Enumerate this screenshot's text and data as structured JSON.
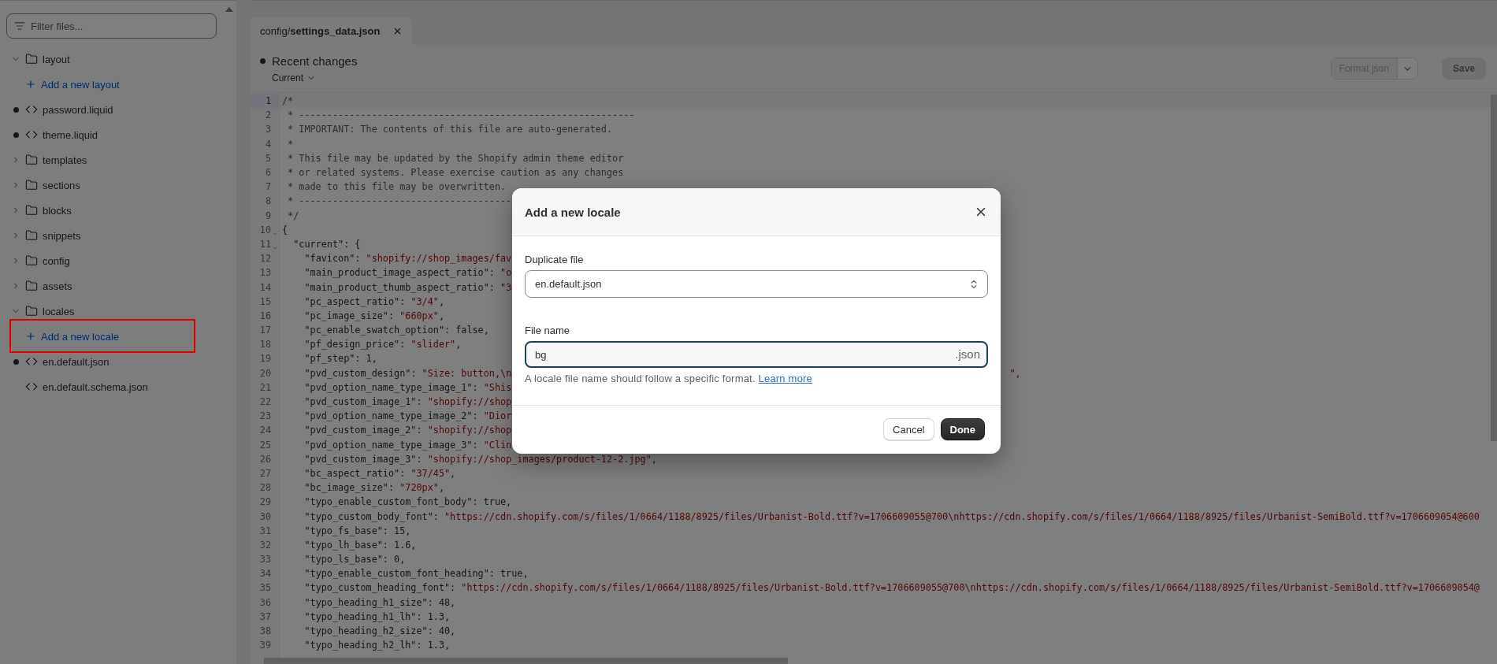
{
  "sidebar": {
    "filter": {
      "placeholder": "Filter files..."
    },
    "items": [
      {
        "kind": "folder",
        "label": "layout",
        "expanded": true,
        "children": [
          {
            "kind": "add",
            "label": "Add a new layout",
            "highlighted": false
          },
          {
            "kind": "file",
            "label": "password.liquid",
            "modified": true
          },
          {
            "kind": "file",
            "label": "theme.liquid",
            "modified": true
          }
        ]
      },
      {
        "kind": "folder",
        "label": "templates",
        "expanded": false
      },
      {
        "kind": "folder",
        "label": "sections",
        "expanded": false
      },
      {
        "kind": "folder",
        "label": "blocks",
        "expanded": false
      },
      {
        "kind": "folder",
        "label": "snippets",
        "expanded": false
      },
      {
        "kind": "folder",
        "label": "config",
        "expanded": false
      },
      {
        "kind": "folder",
        "label": "assets",
        "expanded": false
      },
      {
        "kind": "folder",
        "label": "locales",
        "expanded": true,
        "children": [
          {
            "kind": "add",
            "label": "Add a new locale",
            "highlighted": true
          },
          {
            "kind": "file",
            "label": "en.default.json",
            "modified": true
          },
          {
            "kind": "file",
            "label": "en.default.schema.json",
            "modified": false
          }
        ]
      }
    ]
  },
  "editor": {
    "tab": {
      "label": "config/**settings_data.json**"
    },
    "changes": {
      "title": "Recent changes",
      "version": "Current"
    },
    "format_button": {
      "label": "Format json",
      "disabled": true
    },
    "save_button": {
      "label": "Save",
      "disabled": true
    },
    "code_lines": [
      {
        "n": "1",
        "kind": "comment",
        "text": "/*",
        "active": true,
        "fold": false
      },
      {
        "n": "2",
        "kind": "comment",
        "text": " * ------------------------------------------------------------",
        "active": false,
        "fold": false
      },
      {
        "n": "3",
        "kind": "comment",
        "text": " * IMPORTANT: The contents of this file are auto-generated.",
        "active": false,
        "fold": false
      },
      {
        "n": "4",
        "kind": "comment",
        "text": " *",
        "active": false,
        "fold": false
      },
      {
        "n": "5",
        "kind": "comment",
        "text": " * This file may be updated by the Shopify admin theme editor",
        "active": false,
        "fold": false
      },
      {
        "n": "6",
        "kind": "comment",
        "text": " * or related systems. Please exercise caution as any changes",
        "active": false,
        "fold": false
      },
      {
        "n": "7",
        "kind": "comment",
        "text": " * made to this file may be overwritten.",
        "active": false,
        "fold": false
      },
      {
        "n": "8",
        "kind": "comment",
        "text": " * --------------------------------------",
        "active": false,
        "fold": false
      },
      {
        "n": "9",
        "kind": "comment",
        "text": " */",
        "active": false,
        "fold": false
      },
      {
        "n": "10",
        "kind": "code",
        "text": "{",
        "active": false,
        "fold": true
      },
      {
        "n": "11",
        "kind": "code",
        "text": "  \"current\": {",
        "active": false,
        "fold": true
      },
      {
        "n": "12",
        "kind": "code",
        "text": "    \"favicon\": \"shopify://shop_images/fav",
        "active": false,
        "fold": false
      },
      {
        "n": "13",
        "kind": "code",
        "text": "    \"main_product_image_aspect_ratio\": \"o",
        "active": false,
        "fold": false
      },
      {
        "n": "14",
        "kind": "code",
        "text": "    \"main_product_thumb_aspect_ratio\": \"3",
        "active": false,
        "fold": false
      },
      {
        "n": "15",
        "kind": "code",
        "text": "    \"pc_aspect_ratio\": \"3/4\",",
        "active": false,
        "fold": false
      },
      {
        "n": "16",
        "kind": "code",
        "text": "    \"pc_image_size\": \"660px\",",
        "active": false,
        "fold": false
      },
      {
        "n": "17",
        "kind": "code",
        "text": "    \"pc_enable_swatch_option\": false,",
        "active": false,
        "fold": false
      },
      {
        "n": "18",
        "kind": "code",
        "text": "    \"pf_design_price\": \"slider\",",
        "active": false,
        "fold": false
      },
      {
        "n": "19",
        "kind": "code",
        "text": "    \"pf_step\": 1,",
        "active": false,
        "fold": false
      },
      {
        "n": "20",
        "kind": "code",
        "text": "    \"pvd_custom_design\": \"Size: button,\\n",
        "tail": "\",",
        "active": false,
        "fold": false
      },
      {
        "n": "21",
        "kind": "code",
        "text": "    \"pvd_option_name_type_image_1\": \"Shis",
        "active": false,
        "fold": false
      },
      {
        "n": "22",
        "kind": "code",
        "text": "    \"pvd_custom_image_1\": \"shopify://shop",
        "active": false,
        "fold": false
      },
      {
        "n": "23",
        "kind": "code",
        "text": "    \"pvd_option_name_type_image_2\": \"Dior",
        "active": false,
        "fold": false
      },
      {
        "n": "24",
        "kind": "code",
        "text": "    \"pvd_custom_image_2\": \"shopify://shop",
        "active": false,
        "fold": false
      },
      {
        "n": "25",
        "kind": "code",
        "text": "    \"pvd_option_name_type_image_3\": \"Clin",
        "active": false,
        "fold": false
      },
      {
        "n": "26",
        "kind": "code",
        "text": "    \"pvd_custom_image_3\": \"shopify://shop_images/product-12-2.jpg\",",
        "active": false,
        "fold": false
      },
      {
        "n": "27",
        "kind": "code",
        "text": "    \"bc_aspect_ratio\": \"37/45\",",
        "active": false,
        "fold": false
      },
      {
        "n": "28",
        "kind": "code",
        "text": "    \"bc_image_size\": \"720px\",",
        "active": false,
        "fold": false
      },
      {
        "n": "29",
        "kind": "code",
        "text": "    \"typo_enable_custom_font_body\": true,",
        "active": false,
        "fold": false
      },
      {
        "n": "30",
        "kind": "code",
        "text": "    \"typo_custom_body_font\": \"https://cdn.shopify.com/s/files/1/0664/1188/8925/files/Urbanist-Bold.ttf?v=1706609055@700\\nhttps://cdn.shopify.com/s/files/1/0664/1188/8925/files/Urbanist-SemiBold.ttf?v=1706609054@600",
        "active": false,
        "fold": false
      },
      {
        "n": "31",
        "kind": "code",
        "text": "    \"typo_fs_base\": 15,",
        "active": false,
        "fold": false
      },
      {
        "n": "32",
        "kind": "code",
        "text": "    \"typo_lh_base\": 1.6,",
        "active": false,
        "fold": false
      },
      {
        "n": "33",
        "kind": "code",
        "text": "    \"typo_ls_base\": 0,",
        "active": false,
        "fold": false
      },
      {
        "n": "34",
        "kind": "code",
        "text": "    \"typo_enable_custom_font_heading\": true,",
        "active": false,
        "fold": false
      },
      {
        "n": "35",
        "kind": "code",
        "text": "    \"typo_custom_heading_font\": \"https://cdn.shopify.com/s/files/1/0664/1188/8925/files/Urbanist-Bold.ttf?v=1706609055@700\\nhttps://cdn.shopify.com/s/files/1/0664/1188/8925/files/Urbanist-SemiBold.ttf?v=1706609054@",
        "active": false,
        "fold": false
      },
      {
        "n": "36",
        "kind": "code",
        "text": "    \"typo_heading_h1_size\": 48,",
        "active": false,
        "fold": false
      },
      {
        "n": "37",
        "kind": "code",
        "text": "    \"typo_heading_h1_lh\": 1.3,",
        "active": false,
        "fold": false
      },
      {
        "n": "38",
        "kind": "code",
        "text": "    \"typo_heading_h2_size\": 40,",
        "active": false,
        "fold": false
      },
      {
        "n": "39",
        "kind": "code",
        "text": "    \"typo_heading_h2_lh\": 1.3,",
        "active": false,
        "fold": false
      }
    ]
  },
  "dialog": {
    "title": "Add a new locale",
    "duplicate_label": "Duplicate file",
    "duplicate_value": "en.default.json",
    "name_label": "File name",
    "name_value": "bg",
    "name_suffix": ".json",
    "help": "A locale file name should follow a specific format.",
    "help_link": "Learn more",
    "buttons": [
      {
        "label": "Cancel",
        "kind": "secondary"
      },
      {
        "label": "Done",
        "kind": "primary"
      }
    ]
  }
}
